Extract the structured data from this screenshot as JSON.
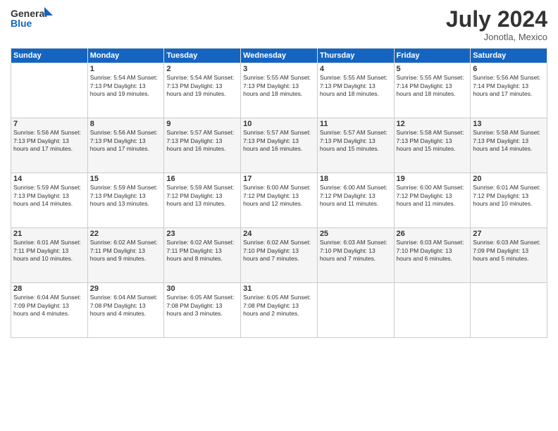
{
  "logo": {
    "line1": "General",
    "line2": "Blue"
  },
  "title": "July 2024",
  "location": "Jonotla, Mexico",
  "days_of_week": [
    "Sunday",
    "Monday",
    "Tuesday",
    "Wednesday",
    "Thursday",
    "Friday",
    "Saturday"
  ],
  "weeks": [
    [
      {
        "day": "",
        "info": ""
      },
      {
        "day": "1",
        "info": "Sunrise: 5:54 AM\nSunset: 7:13 PM\nDaylight: 13 hours\nand 19 minutes."
      },
      {
        "day": "2",
        "info": "Sunrise: 5:54 AM\nSunset: 7:13 PM\nDaylight: 13 hours\nand 19 minutes."
      },
      {
        "day": "3",
        "info": "Sunrise: 5:55 AM\nSunset: 7:13 PM\nDaylight: 13 hours\nand 18 minutes."
      },
      {
        "day": "4",
        "info": "Sunrise: 5:55 AM\nSunset: 7:13 PM\nDaylight: 13 hours\nand 18 minutes."
      },
      {
        "day": "5",
        "info": "Sunrise: 5:55 AM\nSunset: 7:14 PM\nDaylight: 13 hours\nand 18 minutes."
      },
      {
        "day": "6",
        "info": "Sunrise: 5:56 AM\nSunset: 7:14 PM\nDaylight: 13 hours\nand 17 minutes."
      }
    ],
    [
      {
        "day": "7",
        "info": ""
      },
      {
        "day": "8",
        "info": "Sunrise: 5:56 AM\nSunset: 7:13 PM\nDaylight: 13 hours\nand 17 minutes."
      },
      {
        "day": "9",
        "info": "Sunrise: 5:57 AM\nSunset: 7:13 PM\nDaylight: 13 hours\nand 16 minutes."
      },
      {
        "day": "10",
        "info": "Sunrise: 5:57 AM\nSunset: 7:13 PM\nDaylight: 13 hours\nand 16 minutes."
      },
      {
        "day": "11",
        "info": "Sunrise: 5:57 AM\nSunset: 7:13 PM\nDaylight: 13 hours\nand 15 minutes."
      },
      {
        "day": "12",
        "info": "Sunrise: 5:58 AM\nSunset: 7:13 PM\nDaylight: 13 hours\nand 15 minutes."
      },
      {
        "day": "13",
        "info": "Sunrise: 5:58 AM\nSunset: 7:13 PM\nDaylight: 13 hours\nand 14 minutes."
      }
    ],
    [
      {
        "day": "14",
        "info": ""
      },
      {
        "day": "15",
        "info": "Sunrise: 5:59 AM\nSunset: 7:13 PM\nDaylight: 13 hours\nand 13 minutes."
      },
      {
        "day": "16",
        "info": "Sunrise: 5:59 AM\nSunset: 7:12 PM\nDaylight: 13 hours\nand 13 minutes."
      },
      {
        "day": "17",
        "info": "Sunrise: 6:00 AM\nSunset: 7:12 PM\nDaylight: 13 hours\nand 12 minutes."
      },
      {
        "day": "18",
        "info": "Sunrise: 6:00 AM\nSunset: 7:12 PM\nDaylight: 13 hours\nand 11 minutes."
      },
      {
        "day": "19",
        "info": "Sunrise: 6:00 AM\nSunset: 7:12 PM\nDaylight: 13 hours\nand 11 minutes."
      },
      {
        "day": "20",
        "info": "Sunrise: 6:01 AM\nSunset: 7:12 PM\nDaylight: 13 hours\nand 10 minutes."
      }
    ],
    [
      {
        "day": "21",
        "info": ""
      },
      {
        "day": "22",
        "info": "Sunrise: 6:02 AM\nSunset: 7:11 PM\nDaylight: 13 hours\nand 9 minutes."
      },
      {
        "day": "23",
        "info": "Sunrise: 6:02 AM\nSunset: 7:11 PM\nDaylight: 13 hours\nand 8 minutes."
      },
      {
        "day": "24",
        "info": "Sunrise: 6:02 AM\nSunset: 7:10 PM\nDaylight: 13 hours\nand 7 minutes."
      },
      {
        "day": "25",
        "info": "Sunrise: 6:03 AM\nSunset: 7:10 PM\nDaylight: 13 hours\nand 7 minutes."
      },
      {
        "day": "26",
        "info": "Sunrise: 6:03 AM\nSunset: 7:10 PM\nDaylight: 13 hours\nand 6 minutes."
      },
      {
        "day": "27",
        "info": "Sunrise: 6:03 AM\nSunset: 7:09 PM\nDaylight: 13 hours\nand 5 minutes."
      }
    ],
    [
      {
        "day": "28",
        "info": "Sunrise: 6:04 AM\nSunset: 7:09 PM\nDaylight: 13 hours\nand 4 minutes."
      },
      {
        "day": "29",
        "info": "Sunrise: 6:04 AM\nSunset: 7:08 PM\nDaylight: 13 hours\nand 4 minutes."
      },
      {
        "day": "30",
        "info": "Sunrise: 6:05 AM\nSunset: 7:08 PM\nDaylight: 13 hours\nand 3 minutes."
      },
      {
        "day": "31",
        "info": "Sunrise: 6:05 AM\nSunset: 7:08 PM\nDaylight: 13 hours\nand 2 minutes."
      },
      {
        "day": "",
        "info": ""
      },
      {
        "day": "",
        "info": ""
      },
      {
        "day": "",
        "info": ""
      }
    ]
  ],
  "week7_sunday_info": "Sunrise: 5:56 AM\nSunset: 7:13 PM\nDaylight: 13 hours\nand 17 minutes.",
  "week14_sunday_info": "Sunrise: 5:59 AM\nSunset: 7:13 PM\nDaylight: 13 hours\nand 14 minutes.",
  "week21_sunday_info": "Sunrise: 6:01 AM\nSunset: 7:11 PM\nDaylight: 13 hours\nand 10 minutes."
}
